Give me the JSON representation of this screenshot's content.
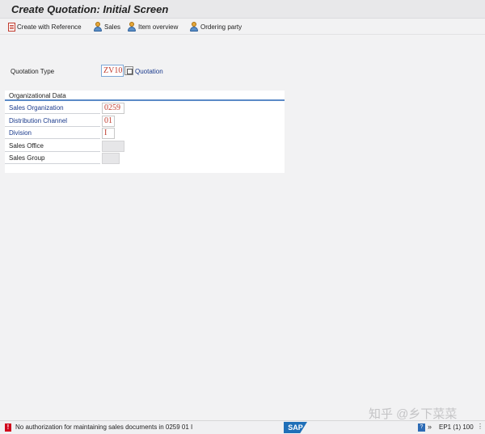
{
  "window": {
    "title": "Create Quotation: Initial Screen"
  },
  "toolbar": {
    "buttons": [
      {
        "label": "Create with Reference",
        "icon": "document-icon"
      },
      {
        "label": "Sales",
        "icon": "person-icon"
      },
      {
        "label": "Item overview",
        "icon": "person-icon"
      },
      {
        "label": "Ordering party",
        "icon": "person-icon"
      }
    ]
  },
  "quotation_type": {
    "label": "Quotation Type",
    "value": "ZV10",
    "description": "Quotation"
  },
  "org_data": {
    "title": "Organizational Data",
    "fields": [
      {
        "label": "Sales Organization",
        "value": "0259",
        "required": true
      },
      {
        "label": "Distribution Channel",
        "value": "01",
        "required": true
      },
      {
        "label": "Division",
        "value": "I",
        "required": true
      },
      {
        "label": "Sales Office",
        "value": "",
        "required": false
      },
      {
        "label": "Sales Group",
        "value": "",
        "required": false
      }
    ]
  },
  "status_bar": {
    "message": "No authorization for maintaining sales documents in 0259 01 I",
    "message_type": "error",
    "logo": "SAP",
    "system_info": "EP1 (1) 100"
  },
  "watermark": "知乎 @乡下菜菜",
  "colors": {
    "title_bar": "#e8e8ea",
    "background": "#f2f2f3",
    "required_label": "#1a3a8c",
    "field_value": "#c0392b",
    "panel_line": "#5b8ac7",
    "error": "#d0021b",
    "sap_blue": "#1f6fb8"
  }
}
